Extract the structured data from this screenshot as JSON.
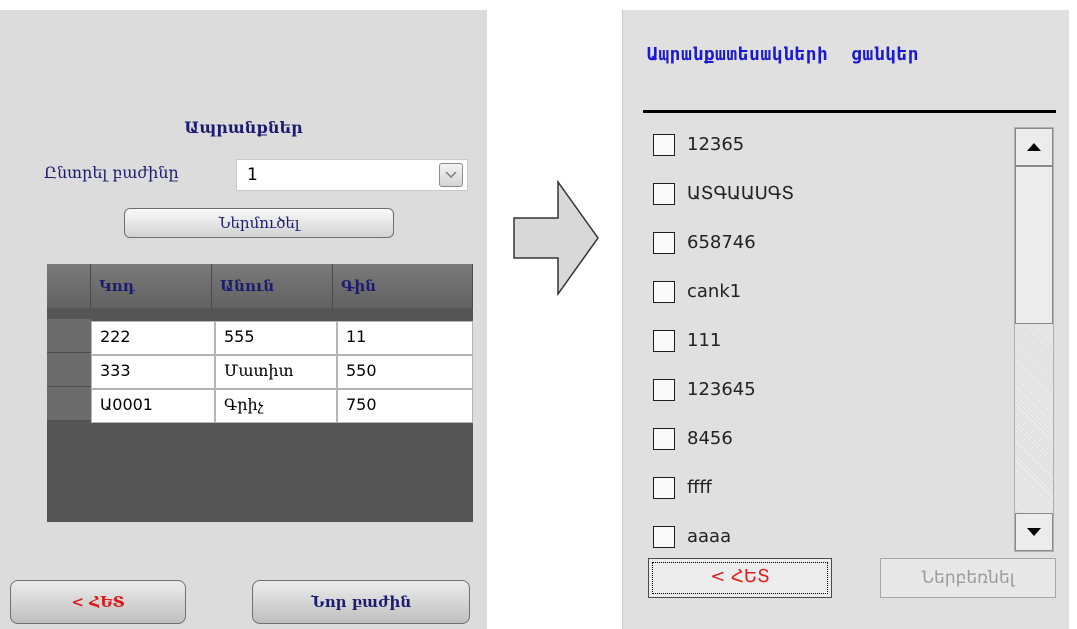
{
  "left_panel": {
    "title": "Ապրանքներ",
    "choose_parts_label": "Ընտրել բաժինը",
    "part_value": "1",
    "import_button": "Ներմուծել",
    "grid": {
      "headers": [
        "Կոդ",
        "Անուն",
        "Գին"
      ],
      "rows": [
        {
          "code": "222",
          "name": "555",
          "price": "11"
        },
        {
          "code": "333",
          "name": "Մատիտ",
          "price": "550"
        },
        {
          "code": "Ա0001",
          "name": "Գրիչ",
          "price": "750"
        }
      ]
    },
    "back_button": "< ՀԵՏ",
    "new_part_button": "Նոր բաժին"
  },
  "right_panel": {
    "title": "Ապրանքատեսակների  ցանկեր",
    "items": [
      {
        "label": "12365",
        "checked": false
      },
      {
        "label": "ԱՏԳԱԱՍԳՏ",
        "checked": false
      },
      {
        "label": "658746",
        "checked": false
      },
      {
        "label": "cank1",
        "checked": false
      },
      {
        "label": "111",
        "checked": false
      },
      {
        "label": "123645",
        "checked": false
      },
      {
        "label": "8456",
        "checked": false
      },
      {
        "label": "ffff",
        "checked": false
      },
      {
        "label": "aaaa",
        "checked": false
      }
    ],
    "back_button": "< ՀԵՏ",
    "import_button": "Ներբեռնել"
  },
  "colors": {
    "accent_blue": "#1a1ad0",
    "dark_navy": "#1c1c6e",
    "back_red": "#e01818",
    "grid_dark": "#555555",
    "panel_gray": "#dcdcdc"
  },
  "icons": [
    "chevron-down-icon",
    "right-arrow-icon",
    "scroll-up-icon",
    "scroll-down-icon"
  ]
}
